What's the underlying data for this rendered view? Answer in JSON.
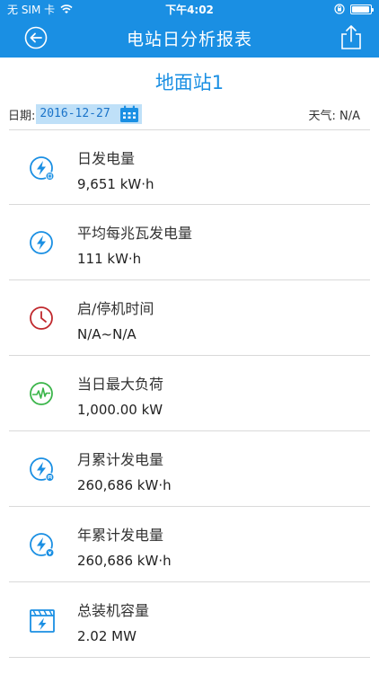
{
  "status_bar": {
    "carrier": "无 SIM 卡",
    "time": "下午4:02",
    "battery_level": 0.95
  },
  "nav": {
    "title": "电站日分析报表",
    "back_icon": "back-circle-arrow-icon",
    "share_icon": "share-upload-icon"
  },
  "station": {
    "name": "地面站1"
  },
  "date_row": {
    "label": "日期:",
    "date": "2016-12-27",
    "weather": "天气: N/A"
  },
  "items": [
    {
      "label": "日发电量",
      "value": "9,651 kW·h",
      "icon": "daily-energy-bolt-icon"
    },
    {
      "label": "平均每兆瓦发电量",
      "value": "111 kW·h",
      "icon": "bolt-icon"
    },
    {
      "label": "启/停机时间",
      "value": "N/A~N/A",
      "icon": "clock-icon"
    },
    {
      "label": "当日最大负荷",
      "value": "1,000.00 kW",
      "icon": "pulse-icon"
    },
    {
      "label": "月累计发电量",
      "value": "260,686 kW·h",
      "icon": "monthly-energy-bolt-icon"
    },
    {
      "label": "年累计发电量",
      "value": "260,686 kW·h",
      "icon": "yearly-energy-bolt-icon"
    },
    {
      "label": "总装机容量",
      "value": "2.02 MW",
      "icon": "capacity-box-icon"
    }
  ],
  "colors": {
    "primary": "#1a8fe3",
    "clock": "#c0282d",
    "pulse": "#3bb54a"
  }
}
